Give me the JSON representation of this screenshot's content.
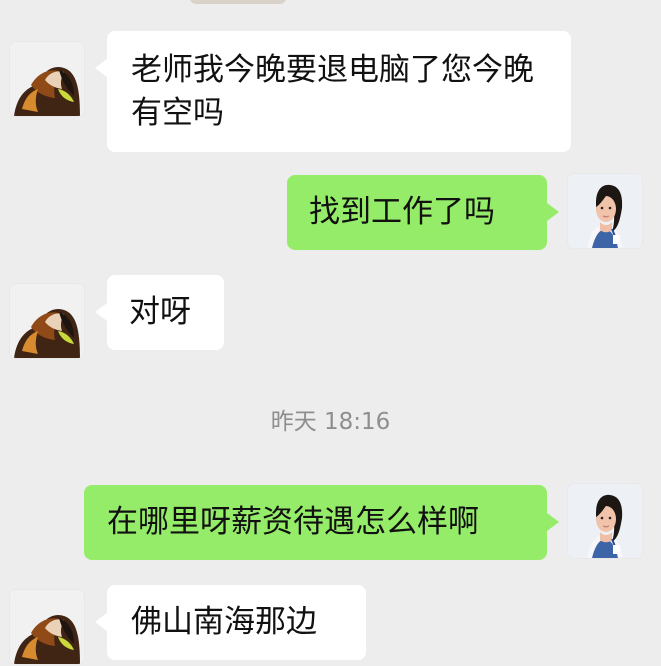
{
  "chat": {
    "timestamp": "昨天 18:16",
    "messages": [
      {
        "side": "left",
        "text": "老师我今晚要退电脑了您今晚有空吗",
        "avatar_icon": "hooded-person-avatar-icon"
      },
      {
        "side": "right",
        "text": "找到工作了吗",
        "avatar_icon": "woman-portrait-avatar-icon"
      },
      {
        "side": "left",
        "text": "对呀",
        "avatar_icon": "hooded-person-avatar-icon"
      },
      {
        "side": "right",
        "text": "在哪里呀薪资待遇怎么样啊",
        "avatar_icon": "woman-portrait-avatar-icon"
      },
      {
        "side": "left",
        "text": "佛山南海那边",
        "avatar_icon": "hooded-person-avatar-icon"
      }
    ]
  },
  "colors": {
    "background": "#ededed",
    "incoming_bubble": "#ffffff",
    "outgoing_bubble": "#95ec69",
    "timestamp_text": "#8e8e8e",
    "message_text": "#111111"
  }
}
